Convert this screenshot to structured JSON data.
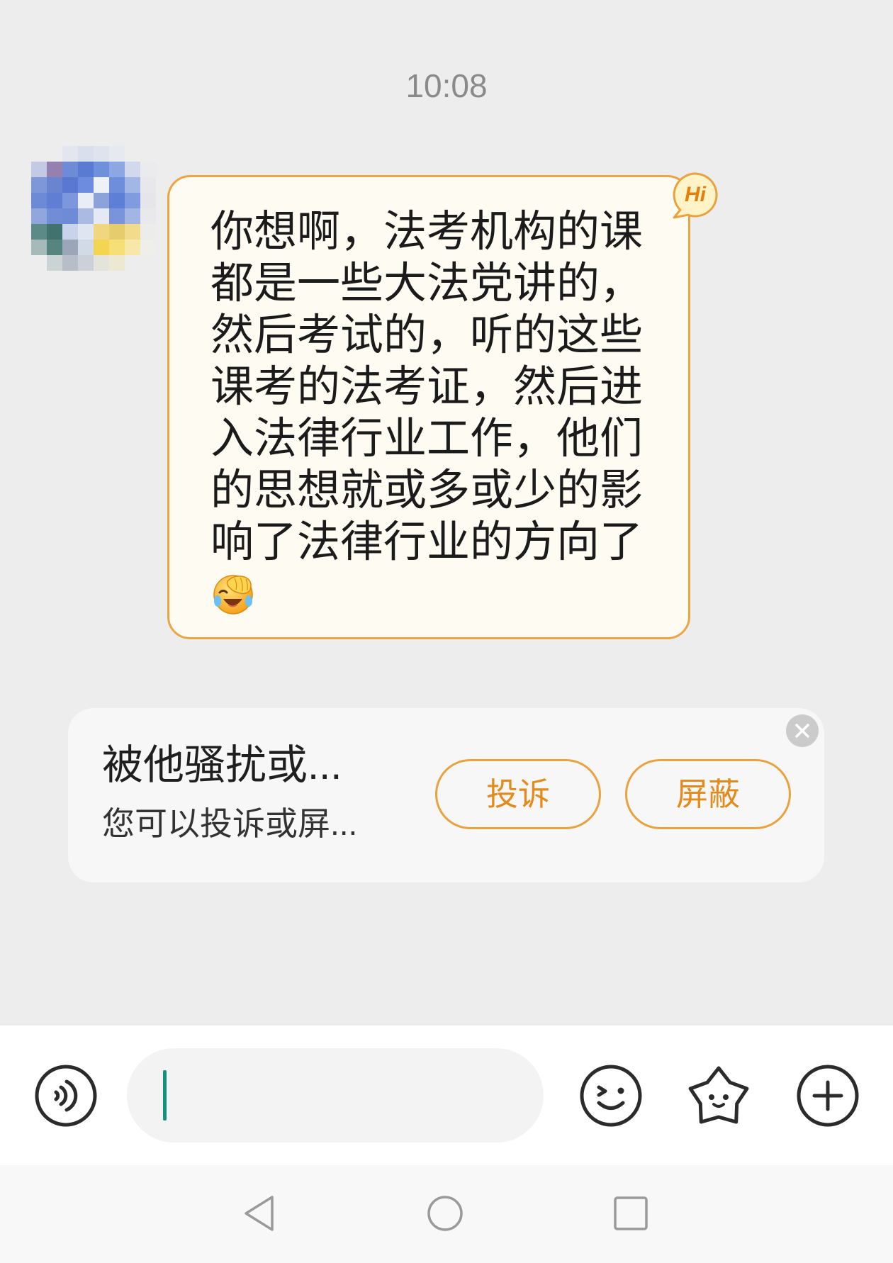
{
  "chat": {
    "timestamp": "10:08",
    "messages": [
      {
        "text": "你想啊，法考机构的课都是一些大法党讲的，然后考试的，听的这些课考的法考证，然后进入法律行业工作，他们的思想就或多或少的影响了法律行业的方向了",
        "emoji_icon": "facepalm-emoji-icon",
        "badge": "Hi",
        "avatar": {
          "mosaic": [
            [
              null,
              null,
              "#e3e6ee",
              "#d9dfec",
              "#dfe3ee",
              "#e6e9f0",
              null,
              null
            ],
            [
              "#c3cbe4",
              "#9580b2",
              "#6f8bd6",
              "#5a7bd2",
              "#7090dc",
              "#8ca7e4",
              "#d2d9ec",
              "#ebebee"
            ],
            [
              "#7d97d9",
              "#6a84d0",
              "#5a78cf",
              "#6d8bdf",
              "#eef1f7",
              "#6e8edc",
              "#a3b7e7",
              "#e8e8ec"
            ],
            [
              "#6c8ad6",
              "#617fd2",
              "#7c97dc",
              "#e9edf6",
              "#8ba3d9",
              "#5d7fd6",
              "#809be0",
              "#e6e6ea"
            ],
            [
              "#91a6de",
              "#728dd6",
              "#6e8bd8",
              "#aabae1",
              "#e4e9f4",
              "#7a94dc",
              "#a2b5e5",
              "#e9e9ec"
            ],
            [
              "#5c8b87",
              "#41726e",
              "#c9d4ea",
              "#e0e6f1",
              "#f0d67e",
              "#e6cc6c",
              "#f2dc8c",
              "#ececea"
            ],
            [
              "#a6bab9",
              "#58847f",
              "#9ba7b9",
              "#d3dae7",
              "#f4d551",
              "#f6df74",
              "#f7e8aa",
              "#eeeeea"
            ],
            [
              null,
              "#cbd3d5",
              "#b7bec8",
              "#cbd0d9",
              "#e4e4dd",
              "#ede8d2",
              null,
              null
            ]
          ]
        }
      }
    ]
  },
  "harassment_prompt": {
    "title": "被他骚扰或...",
    "subtitle": "您可以投诉或屏...",
    "report_label": "投诉",
    "block_label": "屏蔽",
    "close_icon": "close-icon"
  },
  "input_bar": {
    "voice_icon": "voice-icon",
    "message_input": {
      "value": ""
    },
    "emoji_icon": "smiley-wink-icon",
    "sticker_icon": "star-face-icon",
    "more_icon": "plus-circle-icon"
  },
  "nav_bar": {
    "back_icon": "back-triangle-icon",
    "home_icon": "home-circle-icon",
    "recents_icon": "recents-square-icon"
  },
  "colors": {
    "background": "#ededed",
    "bubble_fill": "#fefcf2",
    "bubble_border": "#eba545",
    "accent_orange": "#e9a23e",
    "button_text": "#e38a1c",
    "caret_teal": "#17917f",
    "icon_dark": "#2b2b2b",
    "nav_icon": "#9a9a9a",
    "card_background": "#f7f7f7"
  }
}
